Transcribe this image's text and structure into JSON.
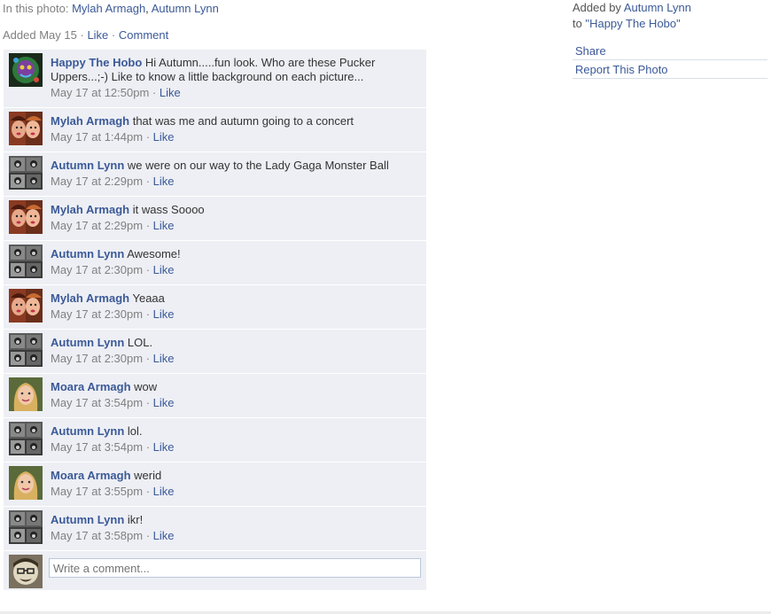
{
  "photo": {
    "in_photo_label": "In this photo:",
    "tagged": [
      "Mylah Armagh",
      "Autumn Lynn"
    ],
    "added_label": "Added May 15",
    "like_label": "Like",
    "comment_label": "Comment",
    "separator": "·"
  },
  "sidebar": {
    "added_by_label": "Added by",
    "added_by_user": "Autumn Lynn",
    "to_label": "to",
    "album_name": "\"Happy The Hobo\"",
    "share_label": "Share",
    "report_label": "Report This Photo"
  },
  "comments": [
    {
      "author": "Happy The Hobo",
      "text": "Hi Autumn.....fun look. Who are these Pucker Uppers...;-) Like to know a little background on each picture...",
      "time": "May 17 at 12:50pm",
      "like": "Like",
      "avatar": "hobo"
    },
    {
      "author": "Mylah Armagh",
      "text": "that was me and autumn going to a concert",
      "time": "May 17 at 1:44pm",
      "like": "Like",
      "avatar": "mylah"
    },
    {
      "author": "Autumn Lynn",
      "text": "we were on our way to the Lady Gaga Monster Ball",
      "time": "May 17 at 2:29pm",
      "like": "Like",
      "avatar": "autumn"
    },
    {
      "author": "Mylah Armagh",
      "text": "it wass Soooo",
      "time": "May 17 at 2:29pm",
      "like": "Like",
      "avatar": "mylah"
    },
    {
      "author": "Autumn Lynn",
      "text": "Awesome!",
      "time": "May 17 at 2:30pm",
      "like": "Like",
      "avatar": "autumn"
    },
    {
      "author": "Mylah Armagh",
      "text": "Yeaaa",
      "time": "May 17 at 2:30pm",
      "like": "Like",
      "avatar": "mylah"
    },
    {
      "author": "Autumn Lynn",
      "text": "LOL.",
      "time": "May 17 at 2:30pm",
      "like": "Like",
      "avatar": "autumn"
    },
    {
      "author": "Moara Armagh",
      "text": "wow",
      "time": "May 17 at 3:54pm",
      "like": "Like",
      "avatar": "moara"
    },
    {
      "author": "Autumn Lynn",
      "text": "lol.",
      "time": "May 17 at 3:54pm",
      "like": "Like",
      "avatar": "autumn"
    },
    {
      "author": "Moara Armagh",
      "text": "werid",
      "time": "May 17 at 3:55pm",
      "like": "Like",
      "avatar": "moara"
    },
    {
      "author": "Autumn Lynn",
      "text": "ikr!",
      "time": "May 17 at 3:58pm",
      "like": "Like",
      "avatar": "autumn"
    }
  ],
  "composer": {
    "placeholder": "Write a comment..."
  },
  "colors": {
    "link": "#3b5998",
    "comment_bg": "#edeff4",
    "meta_gray": "#808080"
  }
}
